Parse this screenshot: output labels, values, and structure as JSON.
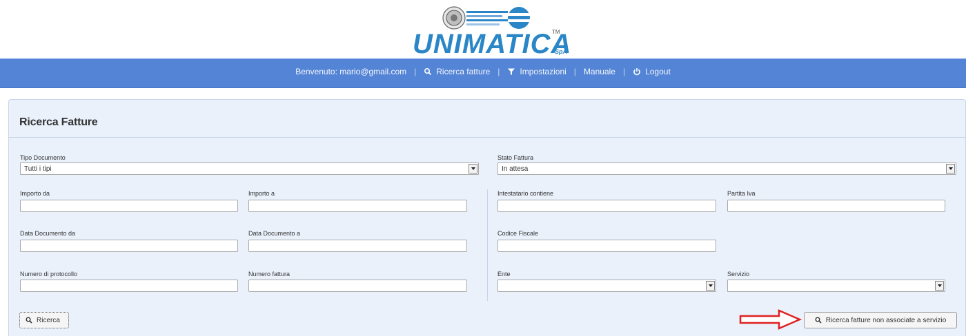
{
  "logo": {
    "text": "UNIMATICA",
    "tm": "TM",
    "spa": "SpA"
  },
  "nav": {
    "welcome": "Benvenuto: mario@gmail.com",
    "ricerca": "Ricerca fatture",
    "impostazioni": "Impostazioni",
    "manuale": "Manuale",
    "logout": "Logout",
    "separator": "|"
  },
  "panel": {
    "title": "Ricerca Fatture"
  },
  "form": {
    "tipo_documento": {
      "label": "Tipo Documento",
      "value": "Tutti i tipi"
    },
    "stato_fattura": {
      "label": "Stato Fattura",
      "value": "In attesa"
    },
    "importo_da": {
      "label": "Importo da",
      "value": ""
    },
    "importo_a": {
      "label": "Importo a",
      "value": ""
    },
    "intestatario": {
      "label": "Intestatario contiene",
      "value": ""
    },
    "partita_iva": {
      "label": "Partita Iva",
      "value": ""
    },
    "data_da": {
      "label": "Data Documento da",
      "value": ""
    },
    "data_a": {
      "label": "Data Documento a",
      "value": ""
    },
    "codice_fiscale": {
      "label": "Codice Fiscale",
      "value": ""
    },
    "numero_protocollo": {
      "label": "Numero di protocollo",
      "value": ""
    },
    "numero_fattura": {
      "label": "Numero fattura",
      "value": ""
    },
    "ente": {
      "label": "Ente",
      "value": ""
    },
    "servizio": {
      "label": "Servizio",
      "value": ""
    }
  },
  "buttons": {
    "ricerca": "Ricerca",
    "non_associate": "Ricerca fatture non associate a servizio"
  },
  "colors": {
    "navbar": "#5484d6",
    "panel": "#eaf1fb",
    "logo_blue": "#2a86c6",
    "arrow": "#e02020"
  }
}
